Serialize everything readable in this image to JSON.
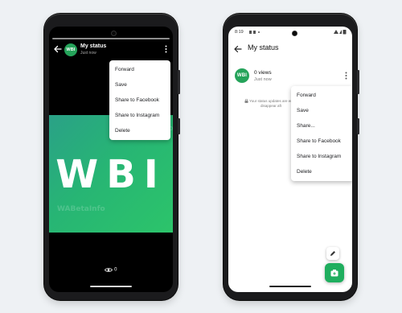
{
  "left_screen": {
    "header": {
      "title": "My status",
      "subtitle": "Just now",
      "avatar_text": "WBI"
    },
    "status_image": {
      "logo_text": "WBI",
      "watermark_text": "WABetaInfo"
    },
    "menu": {
      "items": [
        {
          "label": "Forward"
        },
        {
          "label": "Save"
        },
        {
          "label": "Share to Facebook"
        },
        {
          "label": "Share to Instagram"
        },
        {
          "label": "Delete"
        }
      ]
    },
    "views": {
      "count": "0",
      "icon": "eye-icon"
    }
  },
  "right_screen": {
    "statusbar": {
      "time": "8:19"
    },
    "header": {
      "title": "My status"
    },
    "status_row": {
      "views": "0 views",
      "time": "Just now",
      "avatar_text": "WBI"
    },
    "notice": {
      "line1": "Your status updates are en",
      "line2": "disappear aft"
    },
    "menu": {
      "items": [
        {
          "label": "Forward"
        },
        {
          "label": "Save"
        },
        {
          "label": "Share..."
        },
        {
          "label": "Share to Facebook"
        },
        {
          "label": "Share to Instagram"
        },
        {
          "label": "Delete"
        }
      ]
    }
  },
  "colors": {
    "accent": "#25a35a",
    "fab": "#1fae5e",
    "status_gradient_start": "#2aa187",
    "status_gradient_end": "#2cc46a"
  }
}
